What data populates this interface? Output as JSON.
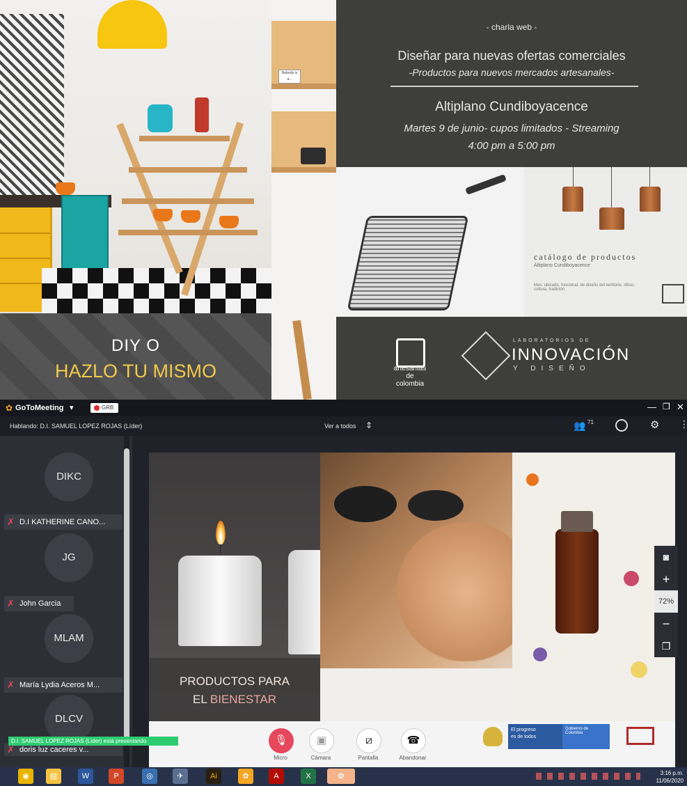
{
  "diy": {
    "line1": "DIY O",
    "line2": "HAZLO TU MISMO"
  },
  "kitchen": {
    "note": "Nobody is a..."
  },
  "poster": {
    "kicker": "- charla web -",
    "title": "Diseñar para nuevas ofertas comerciales",
    "subtitle": "-Productos para nuevos mercados artesanales-",
    "region": "Altiplano Cundiboyacence",
    "date": "Martes 9 de junio-  cupos limitados  -  Streaming",
    "time": "4:00 pm a 5:00 pm",
    "catalog_title": "catálogo de productos",
    "catalog_sub": "Altiplano Cundiboyacence",
    "catalog_small": "Mes: ubicado, funcional, de diseño del territorio, oficio, cultura, tradición",
    "logo1_line1": "artesanías",
    "logo1_line2": "de colombia",
    "logo2_top": "LABORATORIOS DE",
    "logo2_main": "INNOVACIÓN",
    "logo2_bottom": "Y DISEÑO"
  },
  "gotomeeting": {
    "app_name": "GoToMeeting",
    "rec_label": "GRB",
    "speaking": "Hablando: D.I. SAMUEL LOPEZ ROJAS (Líder)",
    "view_mode": "Ver a todos",
    "attendee_count": "71",
    "participants": [
      {
        "initials": "DIKC",
        "name": "D.I KATHERINE CANO..."
      },
      {
        "initials": "JG",
        "name": "John Garcia"
      },
      {
        "initials": "MLAM",
        "name": "María Lydia Aceros M..."
      },
      {
        "initials": "DLCV",
        "name": "doris luz caceres v..."
      }
    ],
    "presenting_notice": "D.I. SAMUEL LOPEZ ROJAS (Líder) está presentando",
    "slide_line1": "PRODUCTOS PARA",
    "slide_line2_a": "EL ",
    "slide_line2_b": "BIENESTAR",
    "controls": {
      "micro": "Micro",
      "camara": "Cámara",
      "pantalla": "Pantalla",
      "abandonar": "Abandonar"
    },
    "zoom_level": "72%",
    "gov_text1": "El progreso",
    "gov_text2": "es de todos",
    "gov_text3": "Gobierno de Colombia"
  },
  "taskbar": {
    "time": "3:16 p.m.",
    "date": "11/06/2020"
  },
  "colors": {
    "accent_yellow": "#f2c94c",
    "poster_bg": "#3e3e3c",
    "mic_red": "#e5475c",
    "bienestar": "#e8a8a0"
  }
}
